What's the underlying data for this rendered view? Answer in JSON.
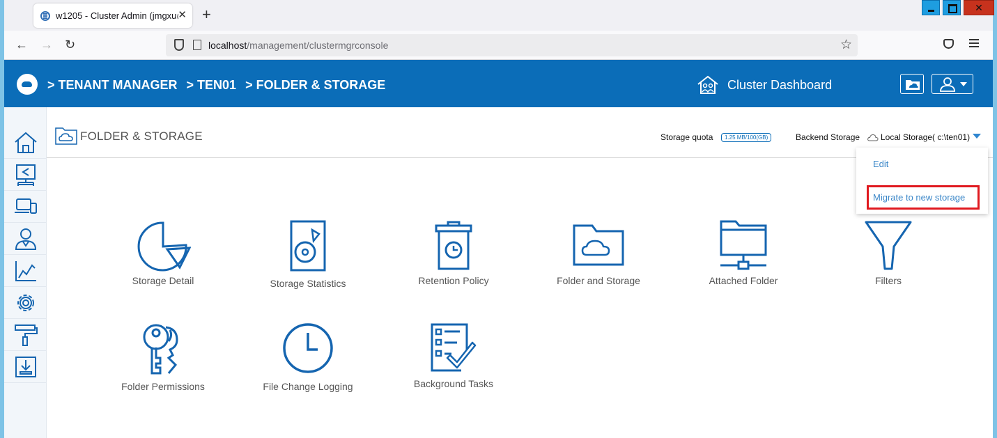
{
  "browser": {
    "tab_title": "w1205 - Cluster Admin (jmgxu@",
    "tab_close": "✕",
    "new_tab": "+",
    "url_host": "localhost",
    "url_path": "/management/clustermgrconsole",
    "nav_back": "←",
    "nav_forward": "→",
    "nav_reload": "↻",
    "bookmark_star": "☆",
    "window_close": "✕"
  },
  "header": {
    "breadcrumb": [
      "> TENANT MANAGER",
      "> TEN01",
      "> FOLDER & STORAGE"
    ],
    "dashboard_label": "Cluster Dashboard"
  },
  "sidebar": {
    "items": [
      {
        "icon": "home-icon"
      },
      {
        "icon": "share-monitor-icon"
      },
      {
        "icon": "devices-icon"
      },
      {
        "icon": "user-icon"
      },
      {
        "icon": "chart-icon"
      },
      {
        "icon": "settings-icon"
      },
      {
        "icon": "paint-roller-icon"
      },
      {
        "icon": "download-icon"
      }
    ]
  },
  "page": {
    "title": "FOLDER & STORAGE",
    "quota_label": "Storage quota",
    "quota_value": "1.25 MB/100(GB)",
    "backend_label": "Backend Storage",
    "backend_value": "Local Storage( c:\\ten01)"
  },
  "dropdown": {
    "edit": "Edit",
    "migrate": "Migrate to new storage",
    "highlight_color": "#e0191f"
  },
  "tiles": [
    {
      "label": "Storage Detail",
      "icon": "pie-chart-icon"
    },
    {
      "label": "Storage Statistics",
      "icon": "hard-drive-icon"
    },
    {
      "label": "Retention Policy",
      "icon": "trash-clock-icon"
    },
    {
      "label": "Folder and Storage",
      "icon": "cloud-folder-icon"
    },
    {
      "label": "Attached Folder",
      "icon": "network-folder-icon"
    },
    {
      "label": "Filters",
      "icon": "funnel-icon"
    },
    {
      "label": "Folder Permissions",
      "icon": "keys-icon"
    },
    {
      "label": "File Change Logging",
      "icon": "clock-icon"
    },
    {
      "label": "Background Tasks",
      "icon": "checklist-icon"
    }
  ],
  "colors": {
    "brand": "#0b6db8",
    "icon_blue": "#1565b0",
    "link_blue": "#3a86c8"
  }
}
